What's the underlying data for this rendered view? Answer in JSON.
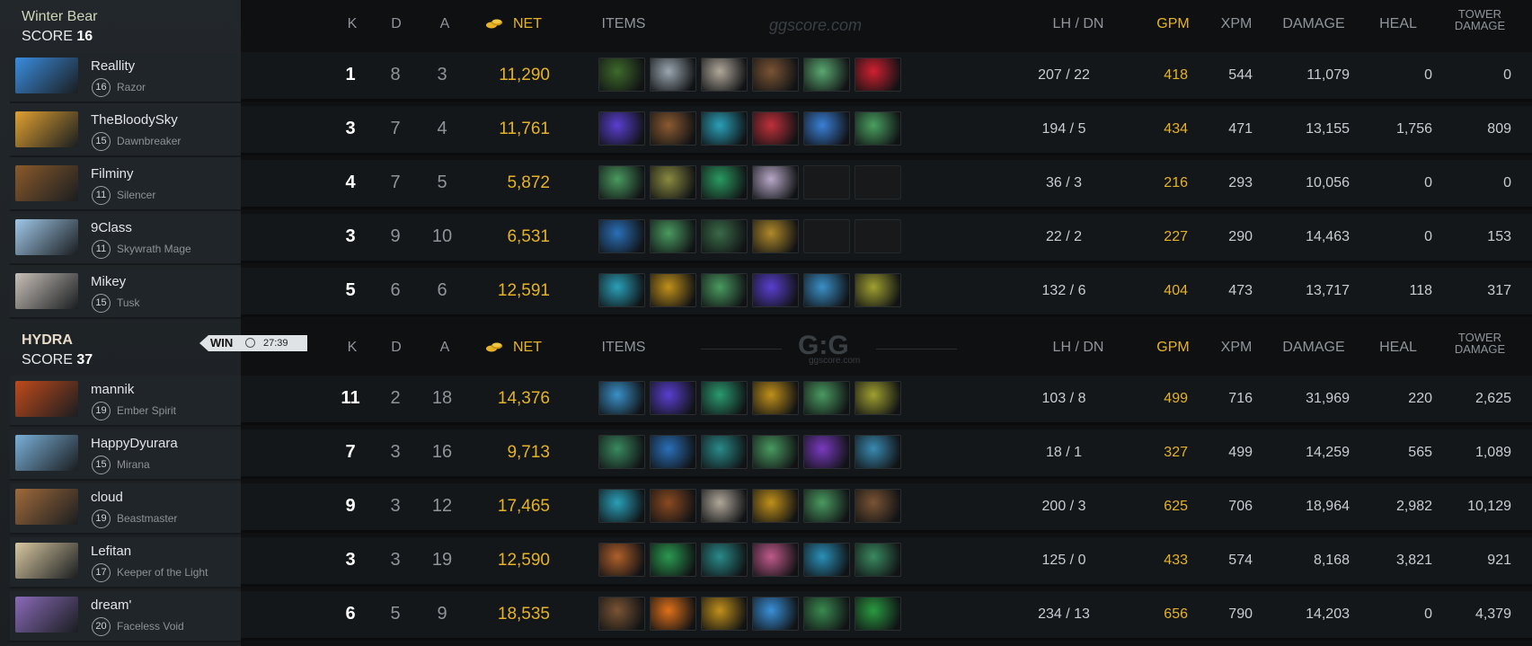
{
  "headers": {
    "k": "K",
    "d": "D",
    "a": "A",
    "net": "NET",
    "items": "ITEMS",
    "lh_dn": "LH  /  DN",
    "gpm": "GPM",
    "xpm": "XPM",
    "damage": "DAMAGE",
    "heal": "HEAL",
    "tower_line1": "TOWER",
    "tower_line2": "DAMAGE"
  },
  "watermark": {
    "text": "ggscore.com",
    "logo": "G:G",
    "logo_sub": "ggscore.com"
  },
  "colors": {
    "gold": "#e6b327",
    "radiant_name": "#cfd6b8",
    "dire_name": "#e8dcc8"
  },
  "match": {
    "result": "WIN",
    "duration": "27:39"
  },
  "teams": [
    {
      "name": "Winter Bear",
      "score_label": "SCORE",
      "score": "16",
      "players": [
        {
          "name": "Reallity",
          "level": "16",
          "hero": "Razor",
          "k": "1",
          "d": "8",
          "a": "3",
          "net": "11,290",
          "items": [
            "#3e6a2a",
            "#9aa6b0",
            "#b0a79a",
            "#7a5434",
            "#5aa870",
            "#d02030"
          ],
          "lh_dn": "207  /  22",
          "gpm": "418",
          "xpm": "544",
          "damage": "11,079",
          "heal": "0",
          "tower": "0",
          "portrait": "#3a8de0"
        },
        {
          "name": "TheBloodySky",
          "level": "15",
          "hero": "Dawnbreaker",
          "k": "3",
          "d": "7",
          "a": "4",
          "net": "11,761",
          "items": [
            "#5a3fd0",
            "#8a5a30",
            "#2aa0b8",
            "#c0303a",
            "#3a80d8",
            "#4aa060"
          ],
          "lh_dn": "194  /  5",
          "gpm": "434",
          "xpm": "471",
          "damage": "13,155",
          "heal": "1,756",
          "tower": "809",
          "portrait": "#e0a030"
        },
        {
          "name": "Filminy",
          "level": "11",
          "hero": "Silencer",
          "k": "4",
          "d": "7",
          "a": "5",
          "net": "5,872",
          "items": [
            "#4a9a60",
            "#8a8a40",
            "#2a9a60",
            "#b8a8c8",
            "",
            ""
          ],
          "lh_dn": "36  /  3",
          "gpm": "216",
          "xpm": "293",
          "damage": "10,056",
          "heal": "0",
          "tower": "0",
          "portrait": "#8a5a2a"
        },
        {
          "name": "9Class",
          "level": "11",
          "hero": "Skywrath Mage",
          "k": "3",
          "d": "9",
          "a": "10",
          "net": "6,531",
          "items": [
            "#2a70b8",
            "#4a9a60",
            "#3a6a48",
            "#b08a2a",
            "",
            ""
          ],
          "lh_dn": "22  /  2",
          "gpm": "227",
          "xpm": "290",
          "damage": "14,463",
          "heal": "0",
          "tower": "153",
          "portrait": "#a0c8e8"
        },
        {
          "name": "Mikey",
          "level": "15",
          "hero": "Tusk",
          "k": "5",
          "d": "6",
          "a": "6",
          "net": "12,591",
          "items": [
            "#2aa0b8",
            "#c0901a",
            "#4a9a60",
            "#5a3fd0",
            "#3a90c8",
            "#a0a030"
          ],
          "lh_dn": "132  /  6",
          "gpm": "404",
          "xpm": "473",
          "damage": "13,717",
          "heal": "118",
          "tower": "317",
          "portrait": "#c8c0b8"
        }
      ]
    },
    {
      "name": "HYDRA",
      "score_label": "SCORE",
      "score": "37",
      "players": [
        {
          "name": "mannik",
          "level": "19",
          "hero": "Ember Spirit",
          "k": "11",
          "d": "2",
          "a": "18",
          "net": "14,376",
          "items": [
            "#3a90c8",
            "#5a3fd0",
            "#2a9a70",
            "#c0901a",
            "#4a9a60",
            "#a0a030"
          ],
          "lh_dn": "103  /  8",
          "gpm": "499",
          "xpm": "716",
          "damage": "31,969",
          "heal": "220",
          "tower": "2,625",
          "portrait": "#c04a1a"
        },
        {
          "name": "HappyDyurara",
          "level": "15",
          "hero": "Mirana",
          "k": "7",
          "d": "3",
          "a": "16",
          "net": "9,713",
          "items": [
            "#3a8a60",
            "#2a70b8",
            "#2a8a8a",
            "#4a9a60",
            "#7a3ac0",
            "#3a8ab0"
          ],
          "lh_dn": "18  /  1",
          "gpm": "327",
          "xpm": "499",
          "damage": "14,259",
          "heal": "565",
          "tower": "1,089",
          "portrait": "#7ab0d8"
        },
        {
          "name": "cloud",
          "level": "19",
          "hero": "Beastmaster",
          "k": "9",
          "d": "3",
          "a": "12",
          "net": "17,465",
          "items": [
            "#2aa0b8",
            "#8a4a20",
            "#b0a79a",
            "#c0901a",
            "#4a9a60",
            "#7a5434"
          ],
          "lh_dn": "200  /  3",
          "gpm": "625",
          "xpm": "706",
          "damage": "18,964",
          "heal": "2,982",
          "tower": "10,129",
          "portrait": "#a06a3a"
        },
        {
          "name": "Lefitan",
          "level": "17",
          "hero": "Keeper of the Light",
          "k": "3",
          "d": "3",
          "a": "19",
          "net": "12,590",
          "items": [
            "#b0602a",
            "#2a9a50",
            "#2a8a8a",
            "#c05a8a",
            "#2a90b8",
            "#3a8a60"
          ],
          "lh_dn": "125  /  0",
          "gpm": "433",
          "xpm": "574",
          "damage": "8,168",
          "heal": "3,821",
          "tower": "921",
          "portrait": "#d8c8a0"
        },
        {
          "name": "dream'",
          "level": "20",
          "hero": "Faceless Void",
          "k": "6",
          "d": "5",
          "a": "9",
          "net": "18,535",
          "items": [
            "#7a5434",
            "#e0701a",
            "#c0901a",
            "#3a90d8",
            "#3a8a50",
            "#2a9a40"
          ],
          "lh_dn": "234  /  13",
          "gpm": "656",
          "xpm": "790",
          "damage": "14,203",
          "heal": "0",
          "tower": "4,379",
          "portrait": "#8a6ab8"
        }
      ]
    }
  ]
}
